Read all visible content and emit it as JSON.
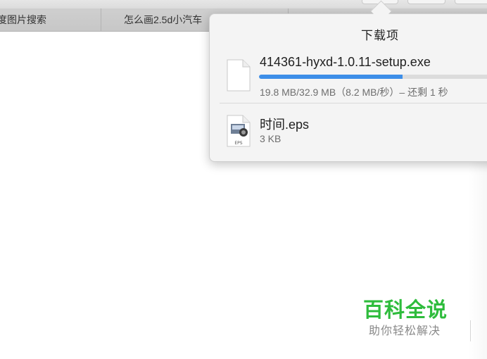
{
  "tabs": [
    {
      "label": "度图片搜索"
    },
    {
      "label": "怎么画2.5d小汽车"
    }
  ],
  "downloads_popover": {
    "title": "下载项",
    "items": [
      {
        "file_name": "414361-hyxd-1.0.11-setup.exe",
        "status": "19.8 MB/32.9 MB（8.2 MB/秒）– 还剩 1 秒",
        "icon": "document-icon",
        "progress_fraction": 0.6
      },
      {
        "file_name": "时间.eps",
        "status": "3 KB",
        "icon": "eps-file-icon",
        "icon_label": "EPS"
      }
    ]
  },
  "watermark": {
    "title": "百科全说",
    "subtitle": "助你轻松解决"
  },
  "colors": {
    "accent_progress": "#3d8ee8",
    "watermark_green": "#2ebc3c",
    "popover_bg": "#f4f4f4"
  }
}
